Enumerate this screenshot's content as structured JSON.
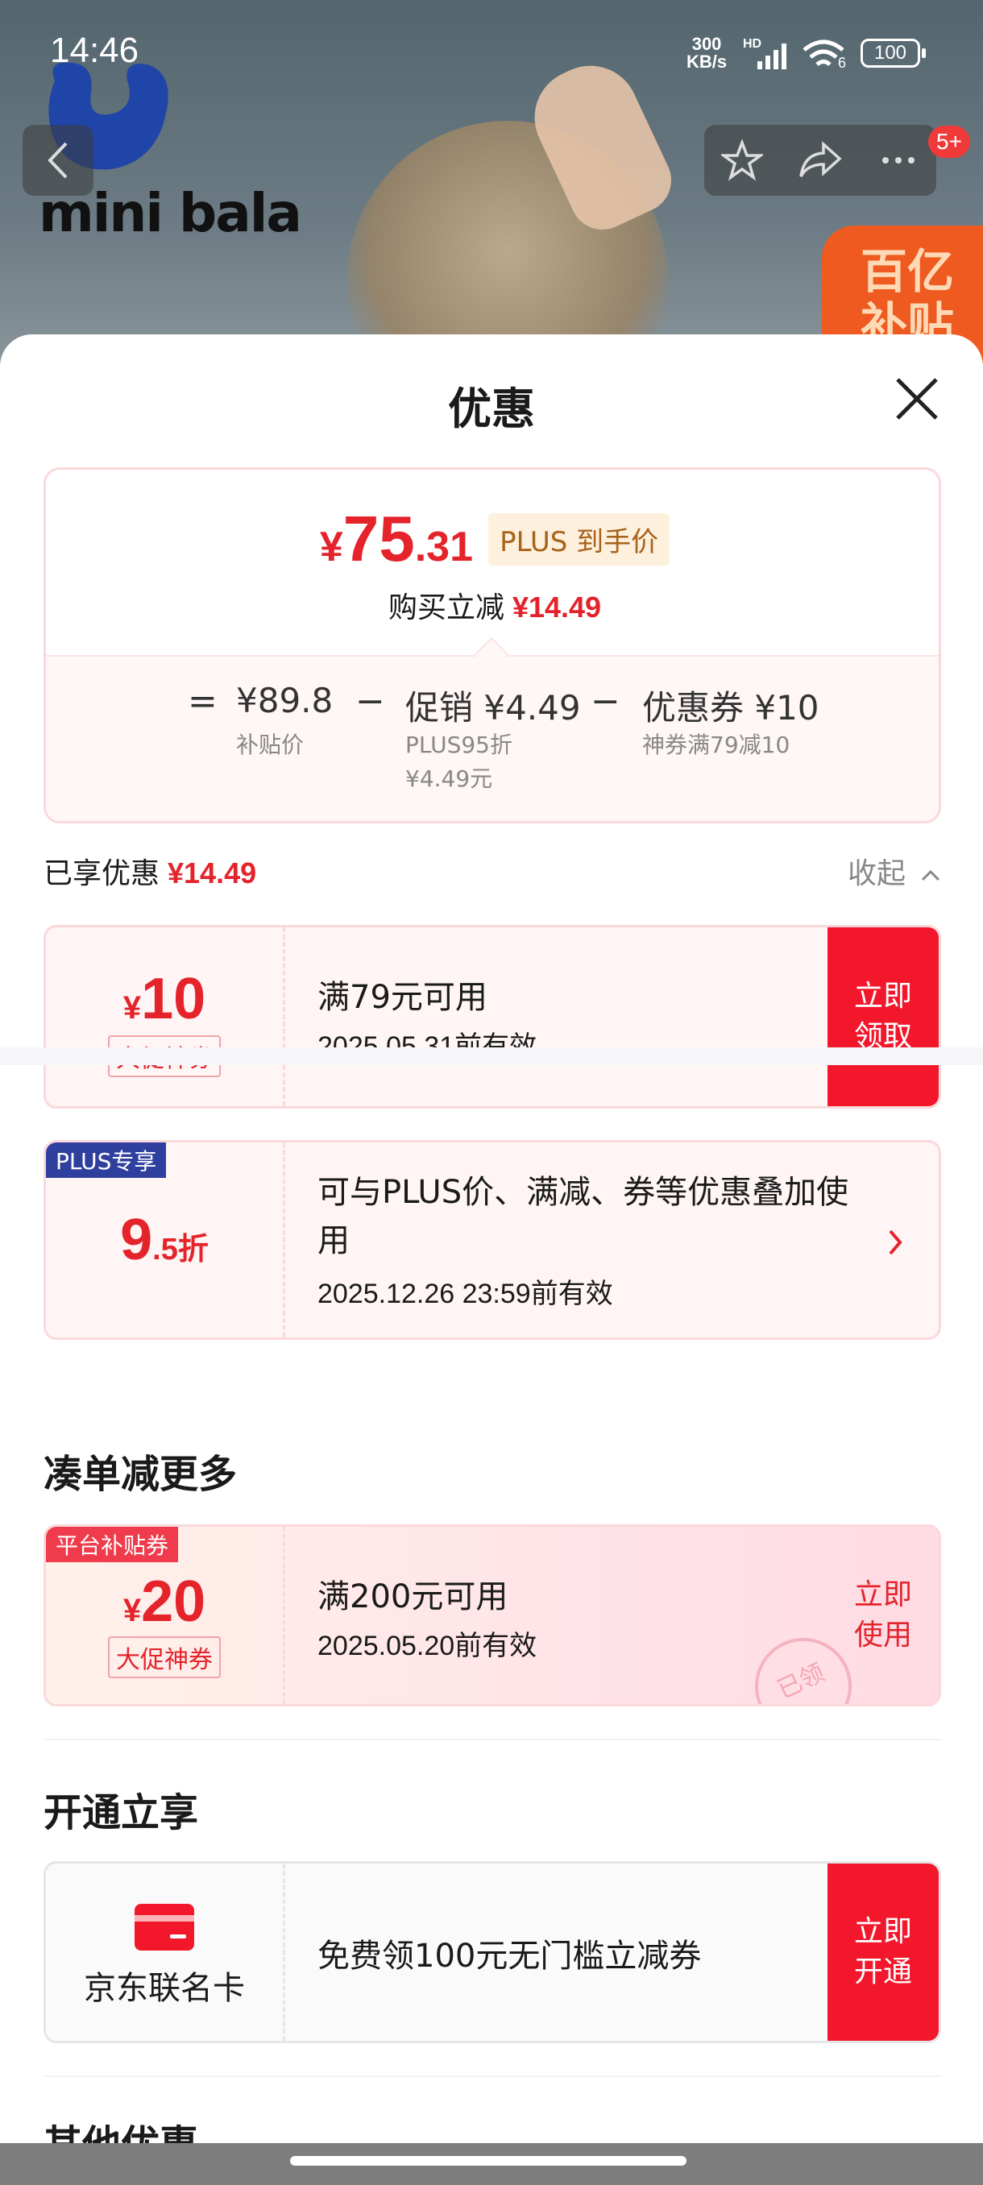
{
  "status_bar": {
    "time": "14:46",
    "network_speed_top": "300",
    "network_speed_unit": "KB/s",
    "hd": "HD",
    "wifi_suffix": "6",
    "battery": "100"
  },
  "background": {
    "brand_logo_text": "mini bala",
    "promo_corner_text": "百亿补贴"
  },
  "nav": {
    "back_icon": "chevron-left-icon",
    "badge": "5+"
  },
  "sheet": {
    "title": "优惠",
    "summary": {
      "price_currency": "¥",
      "price_integer": "75",
      "price_decimal": ".31",
      "plus_tag": "PLUS 到手价",
      "save_label": "购买立减",
      "save_amount": "¥14.49",
      "calc": {
        "eq": "=",
        "base_value": "¥89.8",
        "base_label": "补贴价",
        "minus1": "−",
        "promo_value": "促销 ¥4.49",
        "promo_sub1": "PLUS95折",
        "promo_sub2": "¥4.49元",
        "minus2": "−",
        "coupon_value": "优惠券 ¥10",
        "coupon_sub": "神券满79减10"
      }
    },
    "enjoyed": {
      "label": "已享优惠",
      "amount": "¥14.49",
      "collapse_label": "收起"
    },
    "coupon_1": {
      "currency": "¥",
      "value": "10",
      "tag": "大促神券",
      "condition": "满79元可用",
      "validity": "2025.05.31前有效",
      "action": "立即领取"
    },
    "coupon_plus": {
      "corner_tag": "PLUS专享",
      "discount_int": "9",
      "discount_dec": ".5折",
      "desc": "可与PLUS价、满减、券等优惠叠加使用",
      "validity": "2025.12.26 23:59前有效"
    },
    "section_more": {
      "title": "凑单减更多",
      "coupon": {
        "corner_tag": "平台补贴券",
        "currency": "¥",
        "value": "20",
        "tag": "大促神券",
        "condition": "满200元可用",
        "validity": "2025.05.20前有效",
        "action": "立即使用",
        "stamp": "已领"
      }
    },
    "section_open": {
      "title": "开通立享",
      "card": {
        "card_name": "京东联名卡",
        "desc": "免费领100元无门槛立减券",
        "action": "立即开通"
      }
    },
    "section_other": {
      "title": "其他优惠"
    }
  },
  "colors": {
    "accent_red": "#e4232b",
    "button_red": "#f3172b",
    "plus_blue": "#2f3f9e"
  }
}
